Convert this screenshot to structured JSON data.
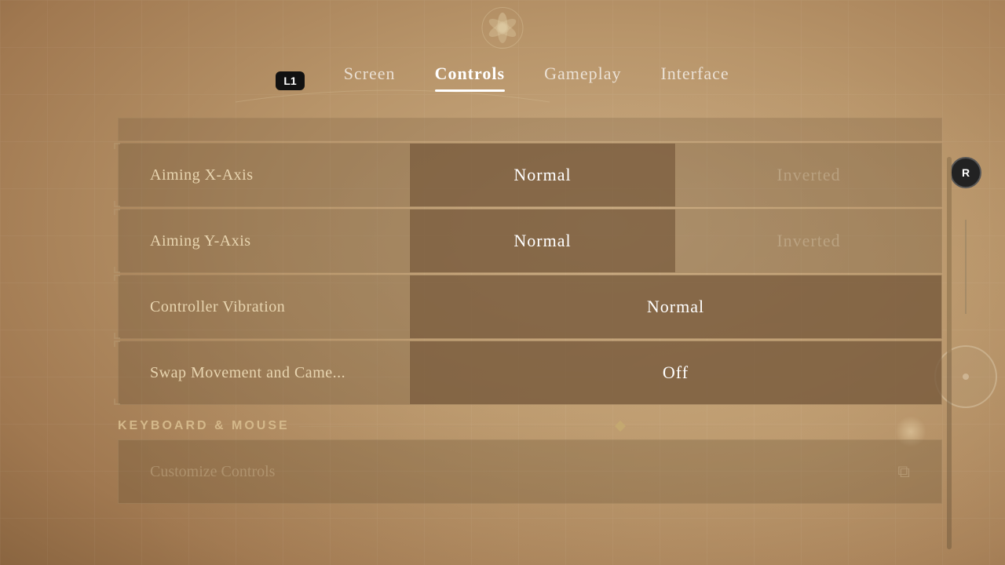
{
  "nav": {
    "l1_label": "L1",
    "tabs": [
      {
        "id": "screen",
        "label": "Screen",
        "active": false
      },
      {
        "id": "controls",
        "label": "Controls",
        "active": true
      },
      {
        "id": "gameplay",
        "label": "Gameplay",
        "active": false
      },
      {
        "id": "interface",
        "label": "Interface",
        "active": false
      }
    ]
  },
  "settings": {
    "rows": [
      {
        "id": "aiming-x",
        "label": "Aiming X-Axis",
        "options": [
          {
            "id": "normal",
            "label": "Normal",
            "selected": true
          },
          {
            "id": "inverted",
            "label": "Inverted",
            "selected": false
          }
        ]
      },
      {
        "id": "aiming-y",
        "label": "Aiming Y-Axis",
        "options": [
          {
            "id": "normal",
            "label": "Normal",
            "selected": true
          },
          {
            "id": "inverted",
            "label": "Inverted",
            "selected": false
          }
        ]
      },
      {
        "id": "controller-vibration",
        "label": "Controller Vibration",
        "options": [
          {
            "id": "normal",
            "label": "Normal",
            "selected": true
          }
        ]
      },
      {
        "id": "swap-movement",
        "label": "Swap Movement and Came...",
        "options": [
          {
            "id": "off",
            "label": "Off",
            "selected": true
          }
        ]
      }
    ],
    "keyboard_section": {
      "title": "KEYBOARD & MOUSE",
      "rows": [
        {
          "id": "customize-controls",
          "label": "Customize Controls",
          "icon": "⧉"
        }
      ]
    }
  },
  "right_indicator": {
    "badge": "R",
    "badge_sub": "↓"
  }
}
